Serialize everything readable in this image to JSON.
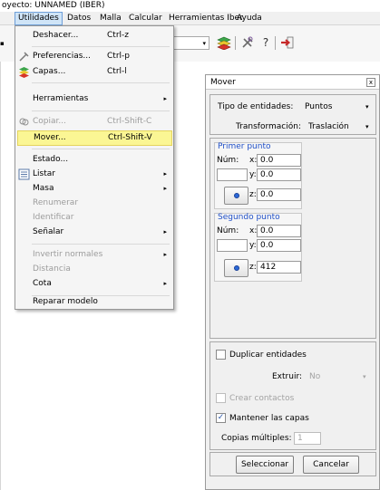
{
  "window": {
    "title": "oyecto: UNNAMED (IBER)"
  },
  "menubar": [
    "Utilidades",
    "Datos",
    "Malla",
    "Calcular",
    "Herramientas Iber",
    "Ayuda"
  ],
  "toolbar": {
    "combo_arrow": "▾",
    "icons": [
      "layers-icon",
      "tools-icon",
      "help-icon",
      "exit-icon"
    ],
    "help_glyph": "?"
  },
  "dropdown": {
    "items": [
      {
        "label": "Deshacer...",
        "shortcut": "Ctrl-z",
        "icon": "",
        "disabled": false,
        "submenu": false
      },
      {
        "label": "Preferencias...",
        "shortcut": "Ctrl-p",
        "icon": "preferences-icon",
        "disabled": false,
        "submenu": false
      },
      {
        "label": "Capas...",
        "shortcut": "Ctrl-l",
        "icon": "layers-icon",
        "disabled": false,
        "submenu": false
      },
      {
        "label": "Herramientas",
        "shortcut": "",
        "icon": "",
        "disabled": false,
        "submenu": true
      },
      {
        "label": "Copiar...",
        "shortcut": "Ctrl-Shift-C",
        "icon": "copy-icon",
        "disabled": true,
        "submenu": false
      },
      {
        "label": "Mover...",
        "shortcut": "Ctrl-Shift-V",
        "icon": "",
        "disabled": false,
        "submenu": false,
        "highlighted": true
      },
      {
        "label": "Estado...",
        "shortcut": "",
        "icon": "",
        "disabled": false,
        "submenu": false
      },
      {
        "label": "Listar",
        "shortcut": "",
        "icon": "list-icon",
        "disabled": false,
        "submenu": true
      },
      {
        "label": "Masa",
        "shortcut": "",
        "icon": "",
        "disabled": false,
        "submenu": true
      },
      {
        "label": "Renumerar",
        "shortcut": "",
        "icon": "",
        "disabled": true,
        "submenu": false
      },
      {
        "label": "Identificar",
        "shortcut": "",
        "icon": "",
        "disabled": true,
        "submenu": false
      },
      {
        "label": "Señalar",
        "shortcut": "",
        "icon": "",
        "disabled": false,
        "submenu": true
      },
      {
        "label": "Invertir normales",
        "shortcut": "",
        "icon": "",
        "disabled": true,
        "submenu": true
      },
      {
        "label": "Distancia",
        "shortcut": "",
        "icon": "",
        "disabled": true,
        "submenu": false
      },
      {
        "label": "Cota",
        "shortcut": "",
        "icon": "",
        "disabled": false,
        "submenu": true
      },
      {
        "label": "Reparar modelo",
        "shortcut": "",
        "icon": "",
        "disabled": false,
        "submenu": false
      }
    ],
    "submenu_arrow": "▸"
  },
  "panel": {
    "title": "Mover",
    "close": "x",
    "entity_type_label": "Tipo de entidades:",
    "entity_type_value": "Puntos",
    "transform_label": "Transformación:",
    "transform_value": "Traslación",
    "combo_arrow": "▾",
    "p1": {
      "title": "Primer punto",
      "num_label": "Núm:",
      "x_label": "x:",
      "y_label": "y:",
      "z_label": "z:",
      "x": "0.0",
      "y": "0.0",
      "z": "0.0"
    },
    "p2": {
      "title": "Segundo punto",
      "num_label": "Núm:",
      "x_label": "x:",
      "y_label": "y:",
      "z_label": "z:",
      "x": "0.0",
      "y": "0.0",
      "z": "412"
    },
    "duplicate_label": "Duplicar entidades",
    "extrude_label": "Extruir:",
    "extrude_value": "No",
    "contacts_label": "Crear contactos",
    "keep_layers_label": "Mantener las capas",
    "keep_layers_checked": true,
    "copies_label": "Copias múltiples:",
    "copies_value": "1",
    "select_button": "Seleccionar",
    "cancel_button": "Cancelar",
    "check_mark": "✓"
  },
  "colors": {
    "highlight": "#fbf694",
    "accent_blue": "#1f4fc7"
  }
}
